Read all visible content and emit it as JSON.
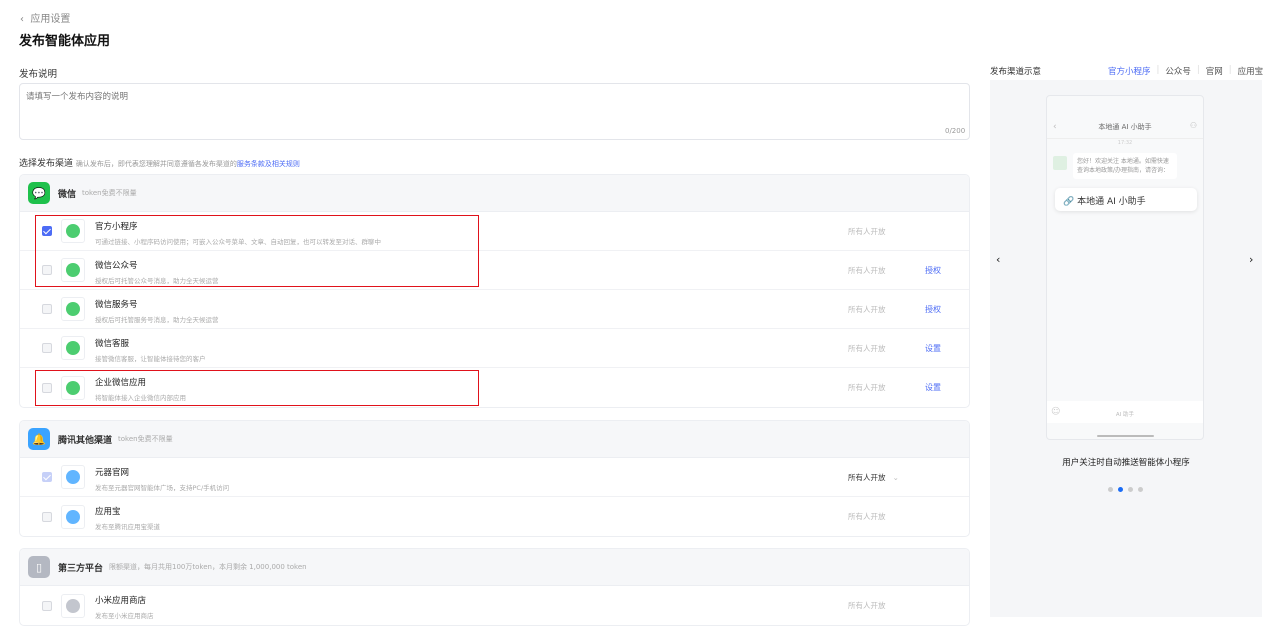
{
  "breadcrumb": {
    "back_label": "应用设置"
  },
  "page_title": "发布智能体应用",
  "description": {
    "label": "发布说明",
    "placeholder": "请填写一个发布内容的说明",
    "counter": "0/200"
  },
  "channels": {
    "label": "选择发布渠道",
    "note": "确认发布后，即代表您理解并同意遵循各发布渠道的",
    "link": "服务条款及相关规则"
  },
  "groups": [
    {
      "name": "微信",
      "sub": "token免费不限量",
      "color": "#1fc14c",
      "rows": [
        {
          "name": "官方小程序",
          "desc": "可通过链接、小程序码访问使用；可嵌入公众号菜单、文章、自动回复，也可以转发至对话、群聊中",
          "perm": "所有人开放",
          "action": "",
          "checked": true
        },
        {
          "name": "微信公众号",
          "desc": "授权后可托管公众号消息，助力全天候运营",
          "perm": "所有人开放",
          "action": "授权",
          "checked": false
        },
        {
          "name": "微信服务号",
          "desc": "授权后可托管服务号消息，助力全天候运营",
          "perm": "所有人开放",
          "action": "授权",
          "checked": false
        },
        {
          "name": "微信客服",
          "desc": "接管微信客服，让智能体接待您的客户",
          "perm": "所有人开放",
          "action": "设置",
          "checked": false
        },
        {
          "name": "企业微信应用",
          "desc": "将智能体接入企业微信内部应用",
          "perm": "所有人开放",
          "action": "设置",
          "checked": false
        }
      ]
    },
    {
      "name": "腾讯其他渠道",
      "sub": "token免费不限量",
      "color": "#3aa3ff",
      "rows": [
        {
          "name": "元器官网",
          "desc": "发布至元器官网智能体广场，支持PC/手机访问",
          "perm": "所有人开放",
          "action": "",
          "checked": true
        },
        {
          "name": "应用宝",
          "desc": "发布至腾讯应用宝渠道",
          "perm": "所有人开放",
          "action": "",
          "checked": false
        }
      ]
    },
    {
      "name": "第三方平台",
      "sub": "限额渠道，每月共用100万token，本月剩余 1,000,000 token",
      "color": "#b4b8c2",
      "rows": [
        {
          "name": "小米应用商店",
          "desc": "发布至小米应用商店",
          "perm": "所有人开放",
          "action": "",
          "checked": false
        }
      ]
    }
  ],
  "preview": {
    "title": "发布渠道示意",
    "tabs": [
      "官方小程序",
      "公众号",
      "官网",
      "应用宝"
    ],
    "active_tab": 0,
    "phone": {
      "header": "本地通 AI 小助手",
      "time": "17:32",
      "message": "您好！欢迎关注 本地通。如需快速查询本地政策/办理指南，请咨询：",
      "card": "本地通 AI 小助手",
      "input": "AI 助手"
    },
    "caption": "用户关注时自动推送智能体小程序",
    "dots": 4,
    "active_dot": 1
  }
}
